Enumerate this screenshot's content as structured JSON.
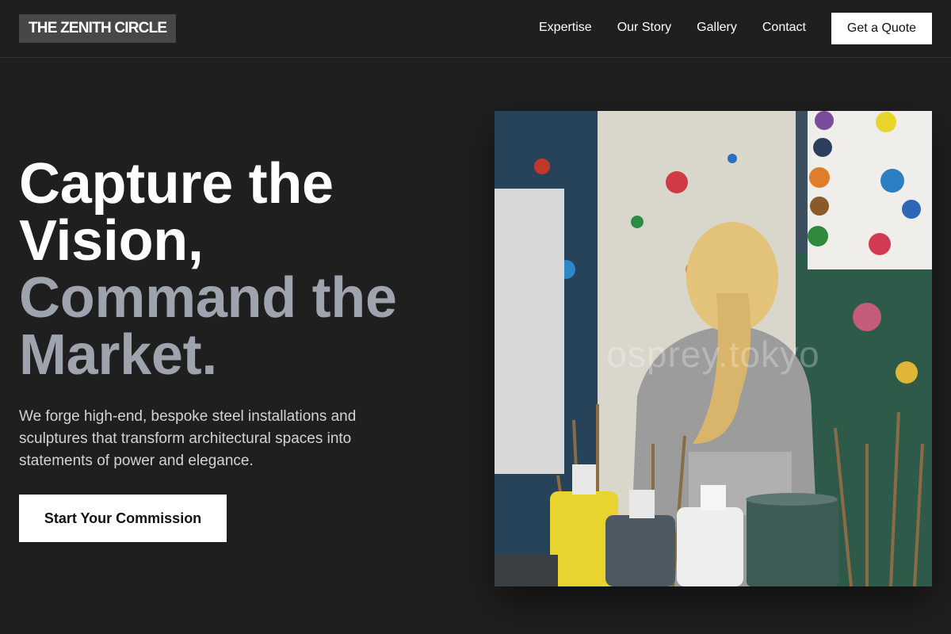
{
  "nav": {
    "logo": "THE ZENITH CIRCLE",
    "links": [
      "Expertise",
      "Our Story",
      "Gallery",
      "Contact"
    ],
    "cta": "Get a Quote"
  },
  "hero": {
    "headline_line1": "Capture the",
    "headline_line2": "Vision,",
    "headline_line3": "Command the",
    "headline_line4": "Market.",
    "subtext": "We forge high-end, bespoke steel installations and sculptures that transform architectural spaces into statements of power and elegance.",
    "cta": "Start Your Commission",
    "image_watermark": "osprey.tokyo"
  },
  "colors": {
    "background": "#1f1f1f",
    "headline_accent": "#9ea3ad",
    "logo_bg": "#474747"
  }
}
